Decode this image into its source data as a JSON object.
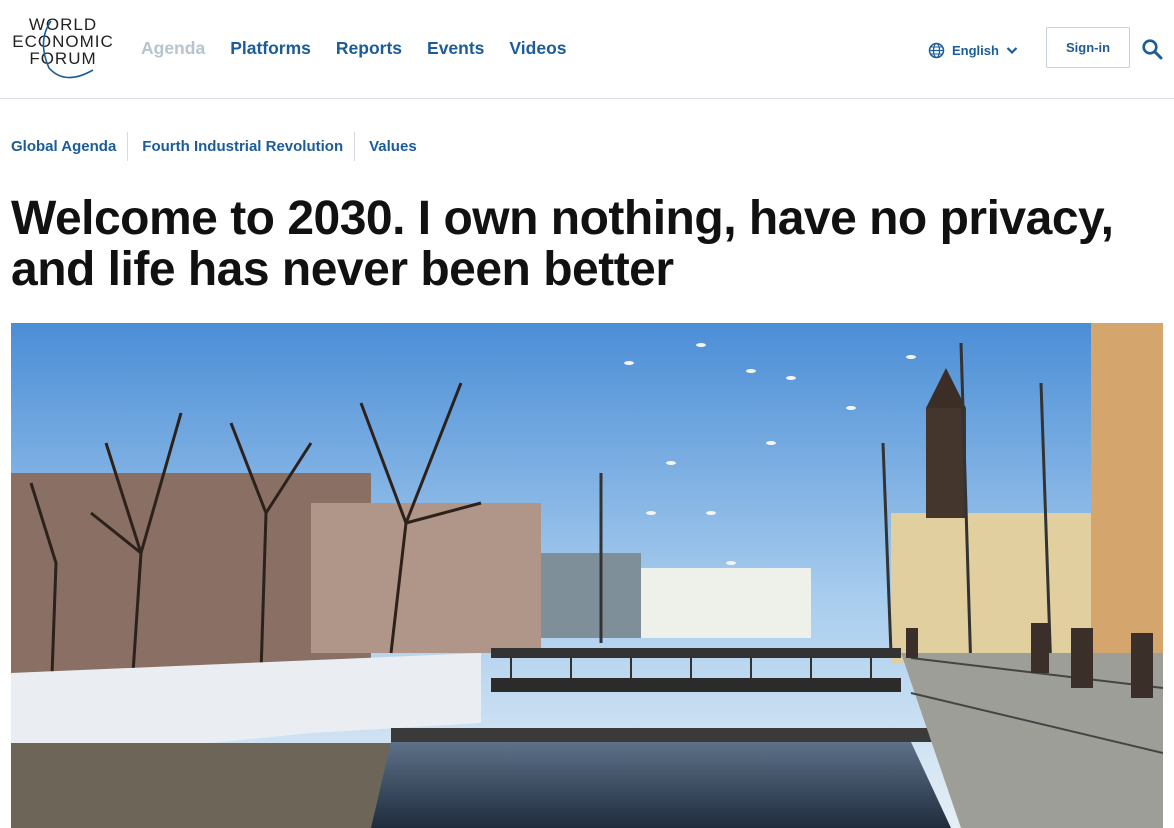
{
  "logo": {
    "line1": "WORLD",
    "line2": "ECONOMIC",
    "line3": "FORUM"
  },
  "nav": {
    "items": [
      {
        "label": "Agenda",
        "active": true
      },
      {
        "label": "Platforms"
      },
      {
        "label": "Reports"
      },
      {
        "label": "Events"
      },
      {
        "label": "Videos"
      }
    ]
  },
  "language": {
    "label": "English"
  },
  "signin": {
    "label": "Sign-in"
  },
  "topics": [
    "Global Agenda",
    "Fourth Industrial Revolution",
    "Values"
  ],
  "article": {
    "title": "Welcome to 2030. I own nothing, have no privacy, and life has never been better"
  },
  "colors": {
    "brand_blue": "#1b5c99",
    "muted_nav": "#b7c4cf"
  },
  "icons": [
    "globe-icon",
    "chevron-down-icon",
    "search-icon"
  ]
}
